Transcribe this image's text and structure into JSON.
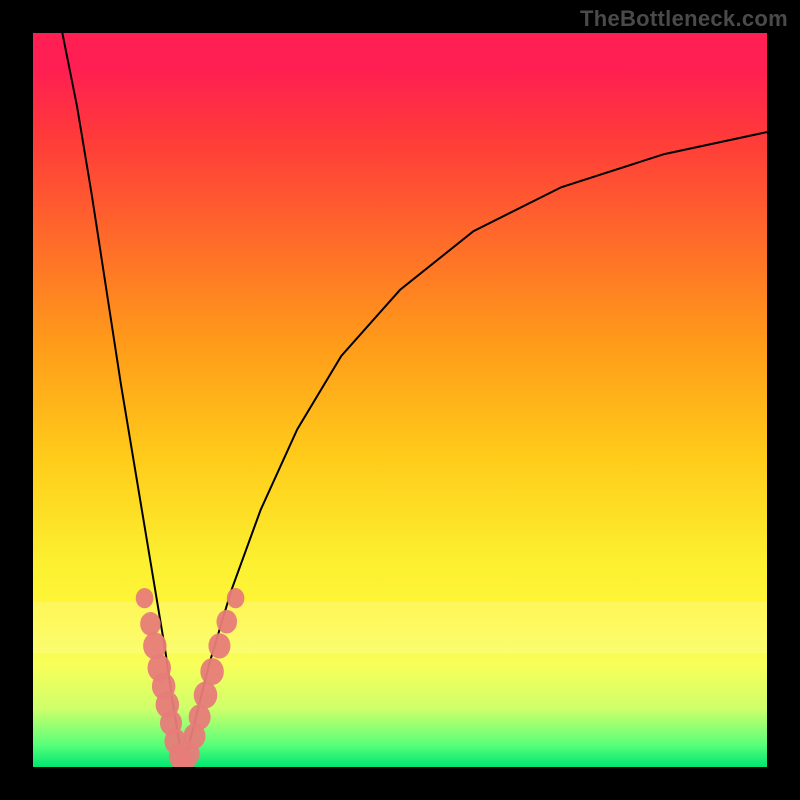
{
  "watermark": "TheBottleneck.com",
  "colors": {
    "frame": "#000000",
    "curve": "#000000",
    "bead": "#e77c79",
    "gradient_top": "#ff1f52",
    "gradient_bottom": "#00e670"
  },
  "chart_data": {
    "type": "line",
    "title": "",
    "xlabel": "",
    "ylabel": "",
    "xlim": [
      0,
      100
    ],
    "ylim": [
      0,
      100
    ],
    "series": [
      {
        "name": "left-branch",
        "x": [
          4,
          6,
          8,
          10,
          12,
          14,
          16,
          18,
          19,
          20,
          20.5
        ],
        "values": [
          100,
          90,
          78,
          65,
          52,
          40,
          28,
          16,
          9,
          3,
          0
        ]
      },
      {
        "name": "right-branch",
        "x": [
          20.5,
          22,
          24,
          27,
          31,
          36,
          42,
          50,
          60,
          72,
          86,
          100
        ],
        "values": [
          0,
          6,
          14,
          24,
          35,
          46,
          56,
          65,
          73,
          79,
          83.5,
          86.5
        ]
      }
    ],
    "markers": [
      {
        "x": 15.2,
        "y": 23.0,
        "r": 1.2
      },
      {
        "x": 16.0,
        "y": 19.5,
        "r": 1.4
      },
      {
        "x": 16.6,
        "y": 16.5,
        "r": 1.6
      },
      {
        "x": 17.2,
        "y": 13.5,
        "r": 1.6
      },
      {
        "x": 17.8,
        "y": 11.0,
        "r": 1.6
      },
      {
        "x": 18.3,
        "y": 8.5,
        "r": 1.6
      },
      {
        "x": 18.8,
        "y": 6.0,
        "r": 1.5
      },
      {
        "x": 19.4,
        "y": 3.5,
        "r": 1.5
      },
      {
        "x": 20.0,
        "y": 1.5,
        "r": 1.5
      },
      {
        "x": 20.5,
        "y": 0.3,
        "r": 1.5
      },
      {
        "x": 21.2,
        "y": 1.8,
        "r": 1.5
      },
      {
        "x": 22.0,
        "y": 4.2,
        "r": 1.5
      },
      {
        "x": 22.7,
        "y": 6.8,
        "r": 1.5
      },
      {
        "x": 23.5,
        "y": 9.8,
        "r": 1.6
      },
      {
        "x": 24.4,
        "y": 13.0,
        "r": 1.6
      },
      {
        "x": 25.4,
        "y": 16.5,
        "r": 1.5
      },
      {
        "x": 26.4,
        "y": 19.8,
        "r": 1.4
      },
      {
        "x": 27.6,
        "y": 23.0,
        "r": 1.2
      }
    ],
    "annotations": []
  }
}
